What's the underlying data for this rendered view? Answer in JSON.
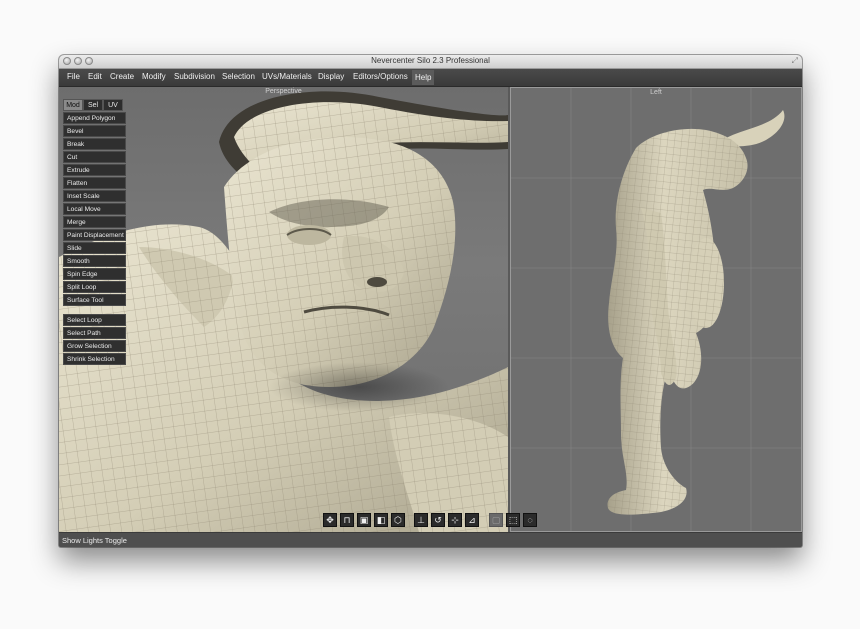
{
  "window": {
    "title": "Nevercenter Silo 2.3 Professional"
  },
  "menubar": {
    "items": [
      "File",
      "Edit",
      "Create",
      "Modify",
      "Subdivision",
      "Selection",
      "UVs/Materials",
      "Display",
      "Editors/Options",
      "Help"
    ],
    "active_item": "Help"
  },
  "viewports": {
    "perspective_label": "Perspective",
    "left_label": "Left"
  },
  "panel": {
    "tabs": [
      "Mod",
      "Sel",
      "UV"
    ],
    "active_tab": "Mod",
    "modify_tools": [
      "Append Polygon",
      "Bevel",
      "Break",
      "Cut",
      "Extrude",
      "Flatten",
      "Inset Scale",
      "Local Move",
      "Merge",
      "Paint Displacement",
      "Slide",
      "Smooth",
      "Spin Edge",
      "Split Loop",
      "Surface Tool"
    ],
    "selection_tools": [
      "Select Loop",
      "Select Path",
      "Grow Selection",
      "Shrink Selection"
    ]
  },
  "toolbar": {
    "buttons": [
      "camera-icon",
      "window-icon",
      "cube-shaded-icon",
      "cube-lit-icon",
      "cube-wire-icon",
      "axis-icon",
      "axis-rotate-icon",
      "axis-move-icon",
      "axis-scale-icon",
      "select-vertex-icon",
      "select-rect-icon",
      "select-lasso-icon"
    ]
  },
  "statusbar": {
    "text": "Show Lights Toggle"
  },
  "colors": {
    "model": "#d9d3bd",
    "menubar": "#3e3e3e",
    "viewport": "#6e6e6e"
  }
}
